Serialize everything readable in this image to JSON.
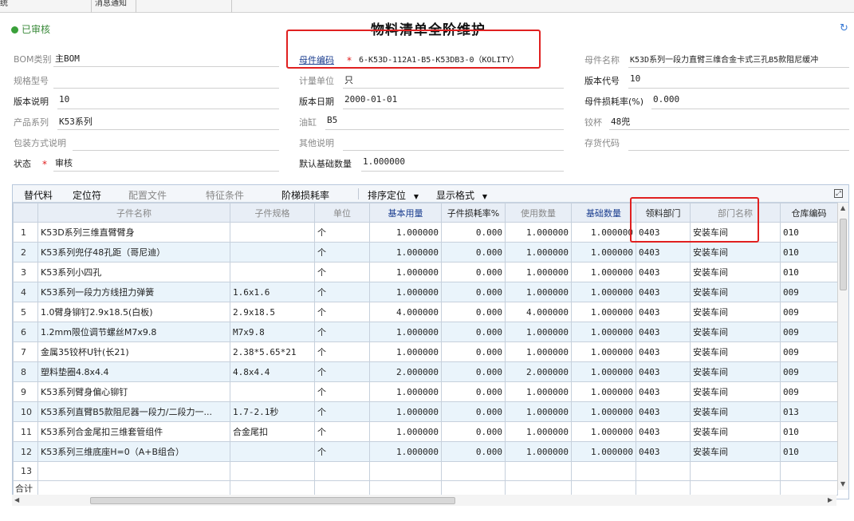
{
  "tabs": [
    {
      "label": "统"
    },
    {
      "label": "消息通知"
    }
  ],
  "header": {
    "status": "已审核",
    "title": "物料清单全阶维护"
  },
  "form": {
    "bom_type": {
      "label": "BOM类别",
      "value": "主BOM"
    },
    "spec_model": {
      "label": "规格型号",
      "value": ""
    },
    "version_desc": {
      "label": "版本说明",
      "value": "10"
    },
    "product_series": {
      "label": "产品系列",
      "value": "K53系列"
    },
    "packing_desc": {
      "label": "包装方式说明",
      "value": ""
    },
    "state": {
      "label": "状态",
      "value": "审核"
    },
    "parent_code": {
      "label": "母件编码",
      "value": "6-K53D-112A1-B5-K53DB3-0（KOLITY）"
    },
    "unit": {
      "label": "计量单位",
      "value": "只"
    },
    "version_date": {
      "label": "版本日期",
      "value": "2000-01-01"
    },
    "oil_cyl": {
      "label": "油缸",
      "value": "B5"
    },
    "other_desc": {
      "label": "其他说明",
      "value": ""
    },
    "default_qty": {
      "label": "默认基础数量",
      "value": "1.000000"
    },
    "parent_name": {
      "label": "母件名称",
      "value": "K53D系列一段力直臂三维合金卡式三孔B5款阻尼缓冲"
    },
    "version_code": {
      "label": "版本代号",
      "value": "10"
    },
    "parent_loss": {
      "label": "母件损耗率(%)",
      "value": "0.000"
    },
    "hinge_cup": {
      "label": "铰杯",
      "value": "48兜"
    },
    "inventory_code": {
      "label": "存货代码",
      "value": ""
    }
  },
  "grid_toolbar": {
    "substitute": "替代料",
    "locator": "定位符",
    "config_file": "配置文件",
    "feature": "特征条件",
    "step_loss": "阶梯损耗率",
    "sort_locate": "排序定位",
    "display_format": "显示格式"
  },
  "grid": {
    "columns": [
      "",
      "子件名称",
      "子件规格",
      "单位",
      "基本用量",
      "子件损耗率%",
      "使用数量",
      "基础数量",
      "领料部门",
      "部门名称",
      "仓库编码"
    ],
    "rows": [
      [
        "1",
        "K53D系列三维直臂臂身",
        "",
        "个",
        "1.000000",
        "0.000",
        "1.000000",
        "1.000000",
        "0403",
        "安装车间",
        "010"
      ],
      [
        "2",
        "K53系列兜仔48孔距（哥尼迪）",
        "",
        "个",
        "1.000000",
        "0.000",
        "1.000000",
        "1.000000",
        "0403",
        "安装车间",
        "010"
      ],
      [
        "3",
        "K53系列小四孔",
        "",
        "个",
        "1.000000",
        "0.000",
        "1.000000",
        "1.000000",
        "0403",
        "安装车间",
        "010"
      ],
      [
        "4",
        "K53系列一段力方线扭力弹簧",
        "1.6x1.6",
        "个",
        "1.000000",
        "0.000",
        "1.000000",
        "1.000000",
        "0403",
        "安装车间",
        "009"
      ],
      [
        "5",
        "1.0臂身铆钉2.9x18.5(白板)",
        "2.9x18.5",
        "个",
        "4.000000",
        "0.000",
        "4.000000",
        "1.000000",
        "0403",
        "安装车间",
        "009"
      ],
      [
        "6",
        "1.2mm限位调节螺丝M7x9.8",
        "M7x9.8",
        "个",
        "1.000000",
        "0.000",
        "1.000000",
        "1.000000",
        "0403",
        "安装车间",
        "009"
      ],
      [
        "7",
        "金属35铰杯U针(长21)",
        "2.38*5.65*21",
        "个",
        "1.000000",
        "0.000",
        "1.000000",
        "1.000000",
        "0403",
        "安装车间",
        "009"
      ],
      [
        "8",
        "塑料垫圈4.8x4.4",
        "4.8x4.4",
        "个",
        "2.000000",
        "0.000",
        "2.000000",
        "1.000000",
        "0403",
        "安装车间",
        "009"
      ],
      [
        "9",
        "K53系列臂身偏心铆钉",
        "",
        "个",
        "1.000000",
        "0.000",
        "1.000000",
        "1.000000",
        "0403",
        "安装车间",
        "009"
      ],
      [
        "10",
        "K53系列直臂B5款阻尼器一段力/二段力一...",
        "1.7-2.1秒",
        "个",
        "1.000000",
        "0.000",
        "1.000000",
        "1.000000",
        "0403",
        "安装车间",
        "013"
      ],
      [
        "11",
        "K53系列合金尾扣三维套管组件",
        "合金尾扣",
        "个",
        "1.000000",
        "0.000",
        "1.000000",
        "1.000000",
        "0403",
        "安装车间",
        "010"
      ],
      [
        "12",
        "K53系列三维底座H=0（A+B组合）",
        "",
        "个",
        "1.000000",
        "0.000",
        "1.000000",
        "1.000000",
        "0403",
        "安装车间",
        "010"
      ]
    ],
    "empty_row": "13",
    "total_label": "合计"
  }
}
